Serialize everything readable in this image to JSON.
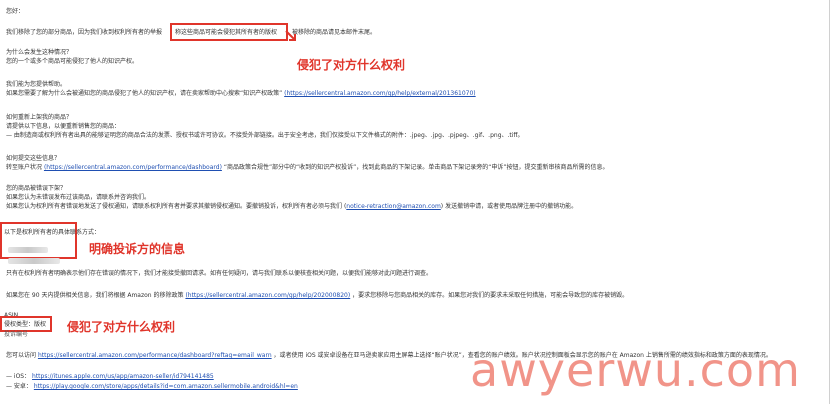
{
  "greeting": "您好：",
  "line1a": "我们移除了您的部分商品，因为我们收到权利所有者的举报",
  "line1_boxed": "称这些商品可能会侵犯其所有者的版权",
  "line1b": "被移除的商品请见本邮件末尾。",
  "q1": "为什么会发生这种情况？",
  "q1a": "您的一个或多个商品可能侵犯了他人的知识产权。",
  "q2": "我们能为您提供帮助。",
  "q2a": "如果您需要了解为什么会被通知您的商品侵犯了他人的知识产权，请在卖家帮助中心搜索“知识产权政策”",
  "q2_link": "(https://sellercentral.amazon.com/gp/help/external/201361070)",
  "q3": "如何重新上架我的商品？",
  "q3a": "请提供以下信息，以便重新销售您的商品：",
  "q3b": "— 由制造商或权利所有者出具的能够证明您的商品合法的发票、授权书或许可协议。不接受外部链接。出于安全考虑，我们仅接受以下文件格式的附件：.jpeg、.jpg、.pjpeg、.gif、.png、.tiff。",
  "q4": "如何提交这些信息？",
  "q4a": "转至账户状况",
  "q4_link": "(https://sellercentral.amazon.com/performance/dashboard)",
  "q4b": "“商品政策合规性”部分中的“收到的知识产权投诉”，找到此商品的下架记录。单击商品下架记录旁的“申诉”按钮，提交重新审核商品所需的信息。",
  "q5": "您的商品被错误下架？",
  "q5a": "如果您认为未错误发布过该商品，请联系并咨询我们。",
  "q5b": "如果您认为权利所有者错误地发送了侵权通知，请联系权利所有者并要求其撤销侵权通知。要撤销投诉，权利所有者必须与我们",
  "q5_link": "notice-retraction@amazon.com",
  "q5c": "发送撤销申请，或者使用品牌注册中的撤销功能。",
  "contact_label": "以下是权利所有者的具体联系方式：",
  "contact_annot": "明确投诉方的信息",
  "p1": "只有在权利所有者明确表示他们存在错误的情况下，我们才能接受撤回请求。如有任何疑问，请与我们联系以便核查相关问题，以便我们能够对此问题进行调查。",
  "p2a": "如果您在 90 天内提供相关信息，我们将根据 Amazon 的移除政策",
  "p2_link": "(https://sellercentral.amazon.com/gp/help/202000820)",
  "p2b": "，要求您移除与您商品相关的库存。如果您对我们的要求未采取任何措施，可能会导致您的库存被销毁。",
  "asin": "ASIN",
  "right_type": "侵权类型：版权",
  "report_id": "投诉编号",
  "right_annot": "侵犯了对方什么权利",
  "top_annot": "侵犯了对方什么权利",
  "p3a": "您可以访问",
  "p3_link": "https://sellercentral.amazon.com/performance/dashboard?reftag=email_warn",
  "p3b": "，或者使用 iOS 或安卓设备在亚马逊卖家应用主屏幕上选择“账户状况”，查看您的账户绩效。账户状况控制面板会显示您的账户在 Amazon 上销售所需的绩效指标和政策方面的表现情况。",
  "ios_label": "— iOS：",
  "ios_link": "https://itunes.apple.com/us/app/amazon-seller/id794141485",
  "android_label": "— 安卓：",
  "android_link": "https://play.google.com/store/apps/details?id=com.amazon.sellermobile.android&hl=en",
  "watermark": "awyerwu.com"
}
